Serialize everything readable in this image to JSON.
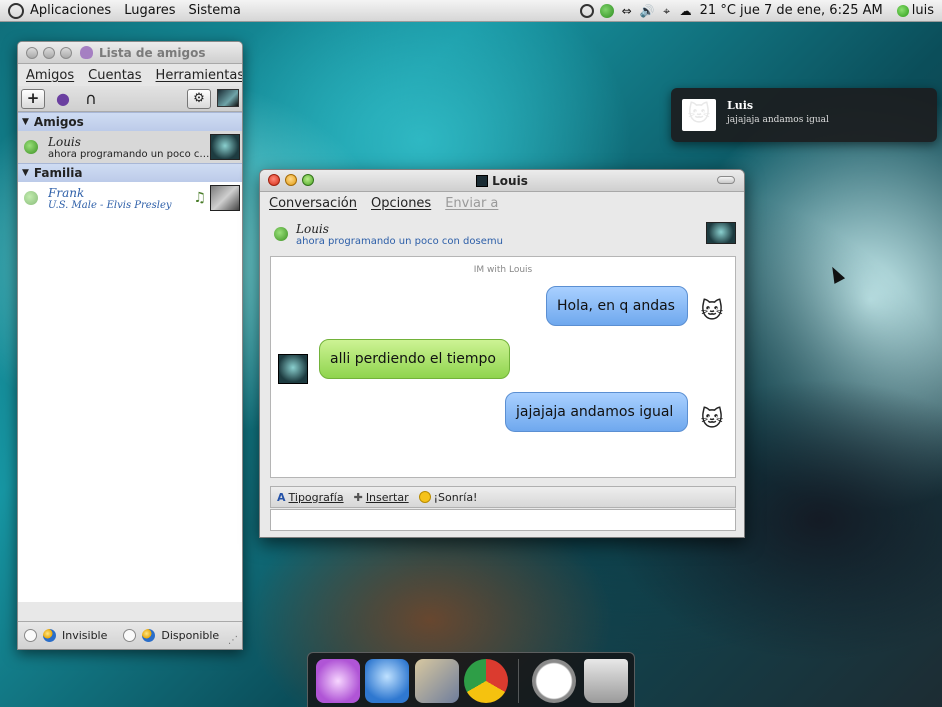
{
  "top_panel": {
    "menus": [
      "Aplicaciones",
      "Lugares",
      "Sistema"
    ],
    "clock": "21 °C jue  7 de ene,  6:25 AM",
    "user": "luis"
  },
  "buddy_list": {
    "title": "Lista de amigos",
    "menus": [
      "Amigos",
      "Cuentas",
      "Herramientas"
    ],
    "add_label": "+",
    "groups": [
      {
        "name": "Amigos",
        "buddies": [
          {
            "name": "Louis",
            "status": "ahora programando un poco con ..."
          }
        ]
      },
      {
        "name": "Familia",
        "buddies": [
          {
            "name": "Frank",
            "status": "U.S. Male - Elvis Presley"
          }
        ]
      }
    ],
    "status_options": [
      "Invisible",
      "Disponible"
    ]
  },
  "conversation": {
    "title": "Louis",
    "menus": [
      "Conversación",
      "Opciones",
      "Enviar a"
    ],
    "buddy_name": "Louis",
    "buddy_status": "ahora programando un poco con dosemu",
    "header": "IM with Louis",
    "messages": [
      {
        "direction": "out",
        "text": "Hola, en q andas"
      },
      {
        "direction": "in",
        "text": "alli perdiendo el tiempo"
      },
      {
        "direction": "out",
        "text": "jajajaja andamos igual"
      }
    ],
    "format_bar": {
      "font": "Tipografía",
      "insert": "Insertar",
      "smile": "¡Sonría!"
    }
  },
  "notification": {
    "title": "Luis",
    "body": "jajajaja    andamos igual"
  },
  "dock": {
    "items": [
      "pidgin-launcher",
      "video-chat",
      "photo-viewer",
      "chrome-browser",
      "clock",
      "trash"
    ]
  }
}
